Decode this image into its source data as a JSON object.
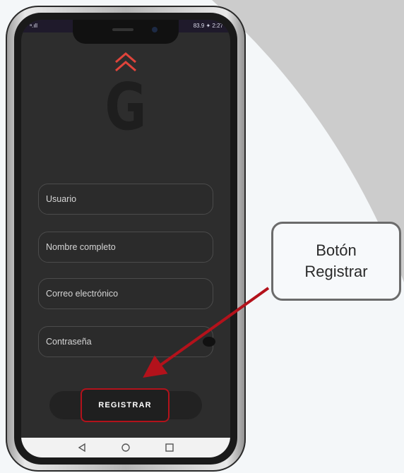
{
  "status_bar": {
    "left": "ᵃ.ıll",
    "right": "83.9 ✦ 2:27"
  },
  "logo": {
    "letter": "G",
    "chevron_color": "#e0443b"
  },
  "form": {
    "username_placeholder": "Usuario",
    "fullname_placeholder": "Nombre completo",
    "email_placeholder": "Correo electrónico",
    "password_placeholder": "Contraseña"
  },
  "register_button": {
    "label": "REGISTRAR",
    "highlight_color": "#b3121b"
  },
  "nav_bar": {
    "back_icon": "◁",
    "home_icon": "○",
    "recents_icon": "□"
  },
  "callout": {
    "text": "Botón\nRegistrar",
    "arrow_color": "#b3121b"
  }
}
